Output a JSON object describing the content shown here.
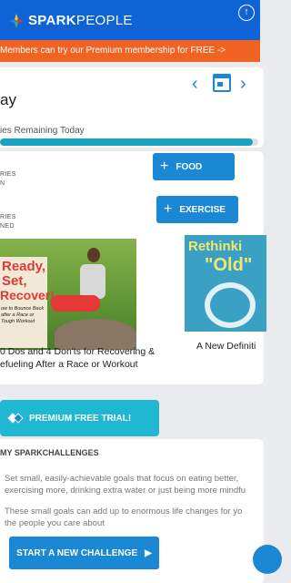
{
  "header": {
    "logo_bold": "SPARK",
    "logo_light": "PEOPLE",
    "up_icon": "arrow-up-circle-icon"
  },
  "promo": {
    "text": "Members can try our Premium membership for FREE ->"
  },
  "day": {
    "title": "ay",
    "prev_icon": "chevron-left-icon",
    "calendar_icon": "calendar-icon",
    "next_icon": "chevron-right-icon",
    "remaining_label": "ies Remaining Today",
    "progress_fraction": 0.98
  },
  "food": {
    "label_line1": "RIES",
    "label_line2": "N",
    "button_label": "FOOD"
  },
  "exercise": {
    "label_line1": "RIES",
    "label_line2": "NED",
    "button_label": "EXERCISE"
  },
  "articles": [
    {
      "title_line1": "0 Dos and 4 Don'ts for Recovering &",
      "title_line2": "efueling After a Race or Workout",
      "image_text_line1": "Ready,",
      "image_text_line2": "Set,",
      "image_text_line3": "Recover!",
      "image_caption": "ow to Bounce Back after a Race or Tough Workout"
    },
    {
      "title_line1": "A New Definiti",
      "image_text_line1": "Rethinki",
      "image_text_line2": "\"Old\""
    }
  ],
  "premium": {
    "button_label": "PREMIUM FREE TRIAL!"
  },
  "challenges": {
    "heading": "MY SPARKCHALLENGES",
    "para1_line1": "Set small, easily-achievable goals that focus on eating better,",
    "para1_line2": "exercising more, drinking extra water or just being more mindfu",
    "para2_line1": "These small goals can add up to enormous life changes for yo",
    "para2_line2": "the people you care about",
    "button_label": "START A NEW CHALLENGE"
  },
  "colors": {
    "header_blue": "#0e63d6",
    "promo_orange": "#f06322",
    "accent_blue": "#1b88d6",
    "premium_teal": "#1fb7d2"
  }
}
